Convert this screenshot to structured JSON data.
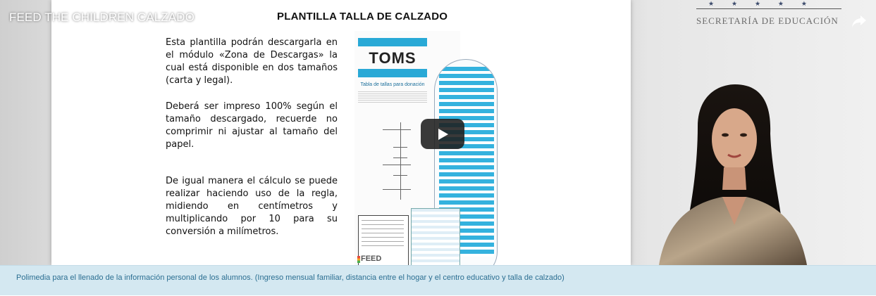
{
  "video": {
    "title": "FEED THE CHILDREN CALZADO",
    "channel_label": "SECRETARÍA DE EDUCACIÓN",
    "share_icon": "share-arrow-icon",
    "play_icon": "youtube-play-icon"
  },
  "slide": {
    "title": "PLANTILLA TALLA DE CALZADO",
    "paragraph1": "Esta plantilla podrán descargarla en el módulo «Zona de Descargas» la cual está disponible en dos tamaños (carta y legal).",
    "paragraph2": "Deberá ser impreso 100% según el tamaño descargado, recuerde no comprimir ni ajustar al tamaño del papel.",
    "paragraph3": "De igual manera el cálculo se puede realizar haciendo uso de la regla, midiendo en centímetros y multiplicando por 10 para su conversión a milímetros.",
    "template": {
      "logo": "TOMS",
      "subtitle": "Tabla de tallas para donación",
      "brand_footer": "FEED"
    }
  },
  "caption": {
    "text": "Polimedia para el llenado de la información personal de los alumnos. (Ingreso mensual familiar, distancia entre el hogar y el centro educativo y talla de calzado)"
  },
  "colors": {
    "caption_bg": "#d4e8f1",
    "caption_text": "#2c6f92",
    "toms_blue": "#29a9d6",
    "play_button_bg": "#1e1e1e"
  }
}
